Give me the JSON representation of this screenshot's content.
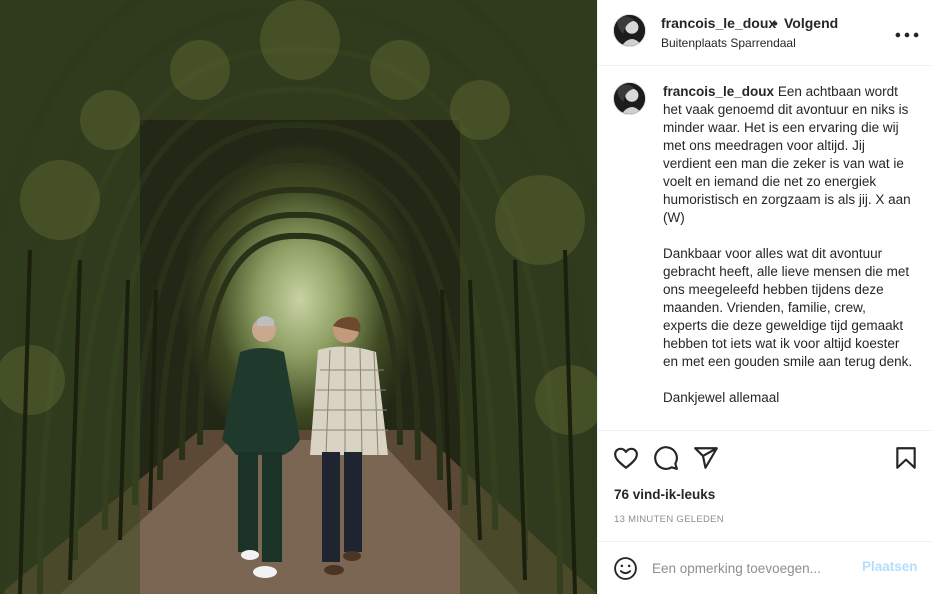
{
  "post": {
    "username": "francois_le_doux",
    "separator": "•",
    "follow_status": "Volgend",
    "location": "Buitenplaats Sparrendaal",
    "caption_paragraphs": [
      "Een achtbaan wordt het vaak genoemd dit avontuur en niks is minder waar. Het is een ervaring die wij met ons meedragen voor altijd. Jij verdient een man die zeker is van wat ie voelt en iemand die net zo energiek humoristisch en zorgzaam is als jij. X aan (W)",
      "Dankbaar voor alles wat dit avontuur gebracht heeft, alle lieve mensen die met ons meegeleefd hebben tijdens deze maanden. Vrienden, familie, crew, experts die deze geweldige tijd gemaakt hebben tot iets wat ik voor altijd koester en met een gouden smile aan terug denk.",
      "Dankjewel allemaal"
    ],
    "likes": "76 vind-ik-leuks",
    "timestamp": "13 MINUTEN GELEDEN"
  },
  "comment_box": {
    "placeholder": "Een opmerking toevoegen...",
    "post_label": "Plaatsen"
  },
  "icons": {
    "more": "more-options-icon",
    "like": "heart-icon",
    "comment": "comment-icon",
    "share": "send-icon",
    "save": "bookmark-icon",
    "emoji": "emoji-icon"
  },
  "colors": {
    "text": "#262626",
    "muted": "#8e8e8e",
    "post_button_disabled": "#b2dffc",
    "divider": "#efefef"
  }
}
